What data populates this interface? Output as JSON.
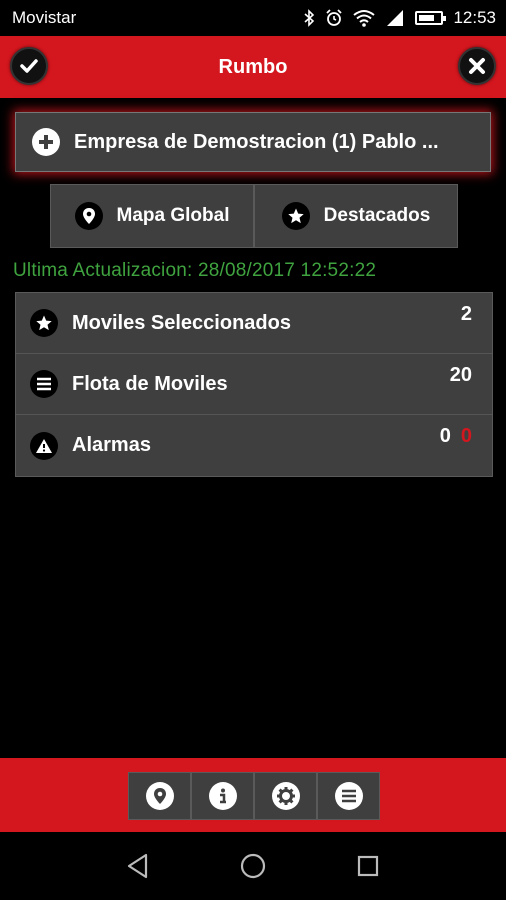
{
  "status_bar": {
    "carrier": "Movistar",
    "time": "12:53",
    "battery_level": 0.75,
    "icons": [
      "bluetooth-icon",
      "alarm-icon",
      "wifi-icon",
      "signal-icon",
      "battery-icon"
    ]
  },
  "app_bar": {
    "title": "Rumbo",
    "left_icon": "check-icon",
    "right_icon": "close-icon",
    "color": "#d4161e"
  },
  "company": {
    "label": "Empresa de Demostracion (1) Pablo ...",
    "icon": "plus-icon"
  },
  "nav": [
    {
      "label": "Mapa Global",
      "icon": "map-pin-icon"
    },
    {
      "label": "Destacados",
      "icon": "star-icon"
    }
  ],
  "last_update": "Ultima Actualizacion: 28/08/2017 12:52:22",
  "list": [
    {
      "label": "Moviles Seleccionados",
      "icon": "star-icon",
      "count": "2"
    },
    {
      "label": "Flota de Moviles",
      "icon": "menu-icon",
      "count": "20"
    },
    {
      "label": "Alarmas",
      "icon": "warning-icon",
      "count": "0",
      "count_alert": "0"
    }
  ],
  "toolbar": [
    "map-pin-icon",
    "info-icon",
    "gear-icon",
    "menu-icon"
  ],
  "system_nav": [
    "back-icon",
    "home-icon",
    "recents-icon"
  ],
  "colors": {
    "accent": "#d4161e",
    "update_text": "#3fa33f",
    "panel": "#3f3f3f"
  }
}
